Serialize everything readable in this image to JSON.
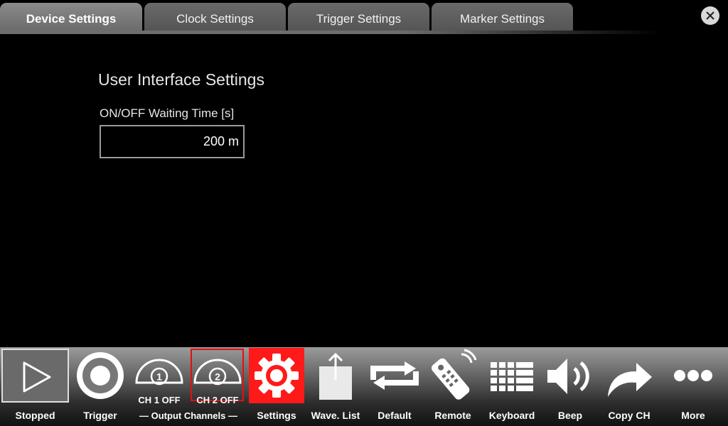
{
  "tabs": [
    {
      "label": "Device Settings",
      "active": true
    },
    {
      "label": "Clock Settings",
      "active": false
    },
    {
      "label": "Trigger Settings",
      "active": false
    },
    {
      "label": "Marker Settings",
      "active": false
    }
  ],
  "close_icon": "close-icon",
  "content": {
    "section_title": "User Interface Settings",
    "field_label": "ON/OFF Waiting Time [s]",
    "field_value": "200 m"
  },
  "toolbar": {
    "stopped": "Stopped",
    "trigger": "Trigger",
    "ch1_state": "CH 1 OFF",
    "ch1_number": "1",
    "ch2_state": "CH 2 OFF",
    "ch2_number": "2",
    "output_channels": "— Output Channels —",
    "settings": "Settings",
    "wave_list": "Wave. List",
    "default": "Default",
    "remote": "Remote",
    "keyboard": "Keyboard",
    "beep": "Beep",
    "copy_ch": "Copy CH",
    "more": "More"
  },
  "colors": {
    "accent_red": "#ff1a1a",
    "selection_red": "#e41010",
    "icon_white": "#ffffff"
  }
}
